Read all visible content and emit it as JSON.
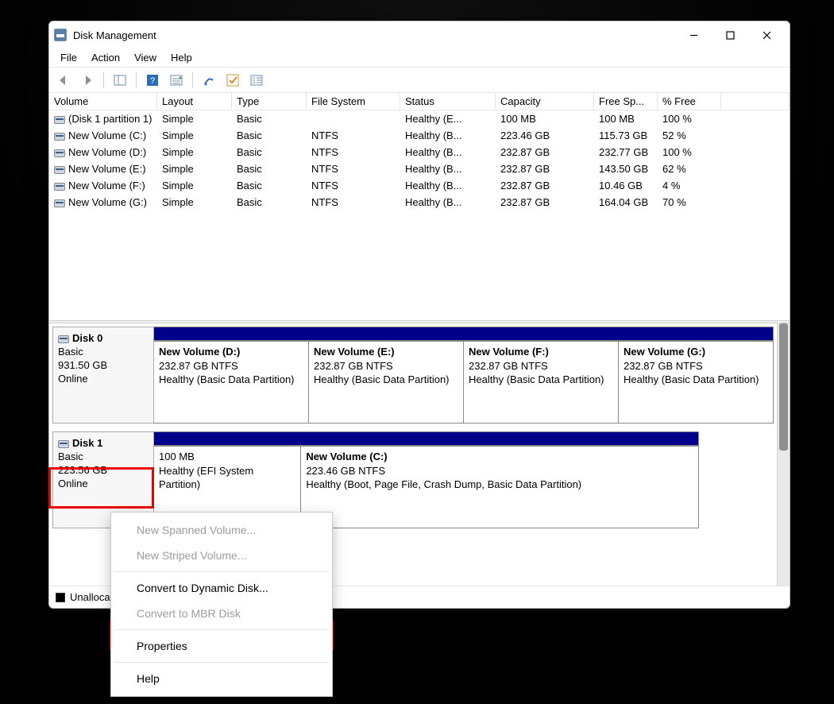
{
  "window": {
    "title": "Disk Management"
  },
  "menu": {
    "file": "File",
    "action": "Action",
    "view": "View",
    "help": "Help"
  },
  "grid": {
    "headers": [
      "Volume",
      "Layout",
      "Type",
      "File System",
      "Status",
      "Capacity",
      "Free Sp...",
      "% Free"
    ],
    "rows": [
      {
        "vol": "(Disk 1 partition 1)",
        "layout": "Simple",
        "type": "Basic",
        "fs": "",
        "status": "Healthy (E...",
        "cap": "100 MB",
        "free": "100 MB",
        "pct": "100 %"
      },
      {
        "vol": "New Volume (C:)",
        "layout": "Simple",
        "type": "Basic",
        "fs": "NTFS",
        "status": "Healthy (B...",
        "cap": "223.46 GB",
        "free": "115.73 GB",
        "pct": "52 %"
      },
      {
        "vol": "New Volume (D:)",
        "layout": "Simple",
        "type": "Basic",
        "fs": "NTFS",
        "status": "Healthy (B...",
        "cap": "232.87 GB",
        "free": "232.77 GB",
        "pct": "100 %"
      },
      {
        "vol": "New Volume (E:)",
        "layout": "Simple",
        "type": "Basic",
        "fs": "NTFS",
        "status": "Healthy (B...",
        "cap": "232.87 GB",
        "free": "143.50 GB",
        "pct": "62 %"
      },
      {
        "vol": "New Volume (F:)",
        "layout": "Simple",
        "type": "Basic",
        "fs": "NTFS",
        "status": "Healthy (B...",
        "cap": "232.87 GB",
        "free": "10.46 GB",
        "pct": "4 %"
      },
      {
        "vol": "New Volume (G:)",
        "layout": "Simple",
        "type": "Basic",
        "fs": "NTFS",
        "status": "Healthy (B...",
        "cap": "232.87 GB",
        "free": "164.04 GB",
        "pct": "70 %"
      }
    ]
  },
  "disks": [
    {
      "name": "Disk 0",
      "type": "Basic",
      "size": "931.50 GB",
      "status": "Online",
      "parts": [
        {
          "title": "New Volume  (D:)",
          "line2": "232.87 GB NTFS",
          "line3": "Healthy (Basic Data Partition)"
        },
        {
          "title": "New Volume  (E:)",
          "line2": "232.87 GB NTFS",
          "line3": "Healthy (Basic Data Partition)"
        },
        {
          "title": "New Volume  (F:)",
          "line2": "232.87 GB NTFS",
          "line3": "Healthy (Basic Data Partition)"
        },
        {
          "title": "New Volume  (G:)",
          "line2": "232.87 GB NTFS",
          "line3": "Healthy (Basic Data Partition)"
        }
      ]
    },
    {
      "name": "Disk 1",
      "type": "Basic",
      "size": "223.56 GB",
      "status": "Online",
      "parts": [
        {
          "title": "",
          "line2": "100 MB",
          "line3": "Healthy (EFI System Partition)"
        },
        {
          "title": "New Volume  (C:)",
          "line2": "223.46 GB NTFS",
          "line3": "Healthy (Boot, Page File, Crash Dump, Basic Data Partition)"
        }
      ]
    }
  ],
  "legend": {
    "unallocated": "Unallocated"
  },
  "context_menu": {
    "new_spanned": "New Spanned Volume...",
    "new_striped": "New Striped Volume...",
    "convert_dynamic": "Convert to Dynamic Disk...",
    "convert_mbr": "Convert to MBR Disk",
    "properties": "Properties",
    "help": "Help"
  }
}
